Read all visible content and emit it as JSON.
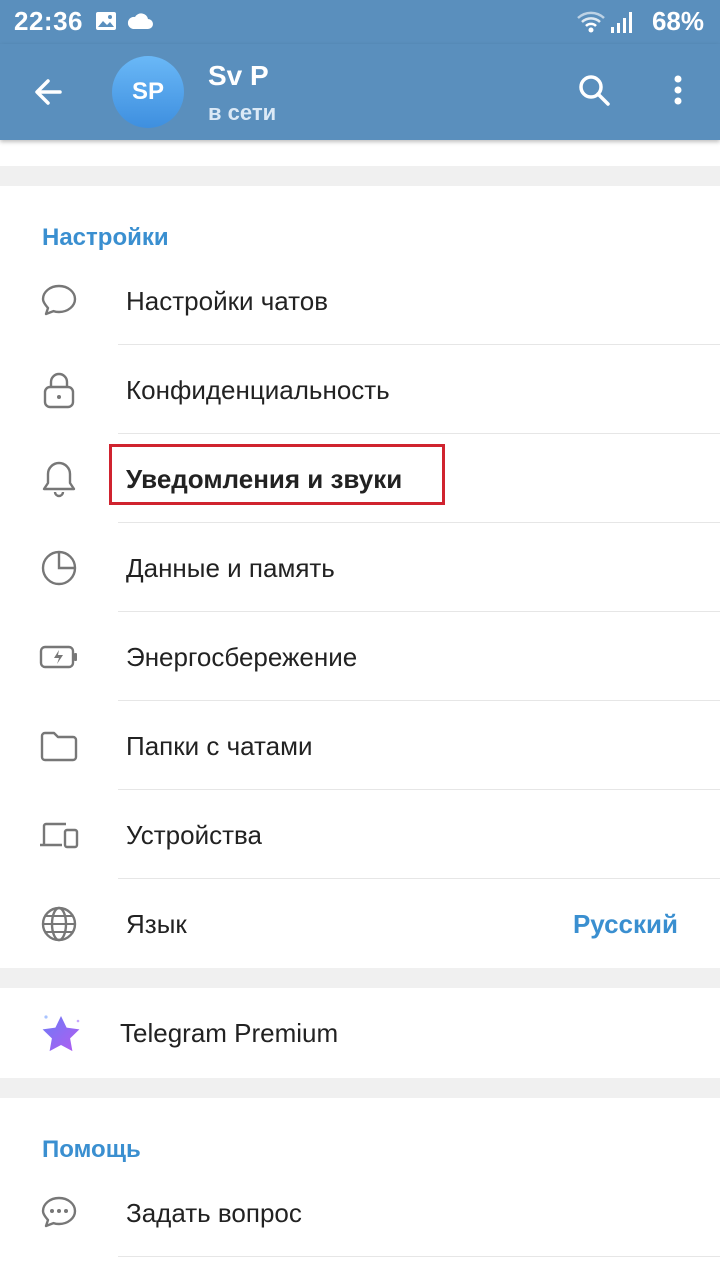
{
  "status_bar": {
    "time": "22:36",
    "battery": "68%"
  },
  "header": {
    "avatar_initials": "SP",
    "name": "Sv P",
    "status": "в сети"
  },
  "settings": {
    "title": "Настройки",
    "items": [
      {
        "label": "Настройки чатов",
        "icon": "chat-bubble-icon"
      },
      {
        "label": "Конфиденциальность",
        "icon": "lock-icon"
      },
      {
        "label": "Уведомления и звуки",
        "icon": "bell-icon"
      },
      {
        "label": "Данные и память",
        "icon": "pie-chart-icon"
      },
      {
        "label": "Энергосбережение",
        "icon": "battery-icon"
      },
      {
        "label": "Папки с чатами",
        "icon": "folder-icon"
      },
      {
        "label": "Устройства",
        "icon": "devices-icon"
      },
      {
        "label": "Язык",
        "icon": "globe-icon",
        "value": "Русский"
      }
    ]
  },
  "premium": {
    "label": "Telegram Premium",
    "icon": "premium-star-icon"
  },
  "help": {
    "title": "Помощь",
    "items": [
      {
        "label": "Задать вопрос",
        "icon": "question-chat-icon"
      }
    ]
  },
  "colors": {
    "header_bg": "#5a8fbd",
    "accent": "#3a8fd0",
    "highlight": "#d0232f"
  }
}
